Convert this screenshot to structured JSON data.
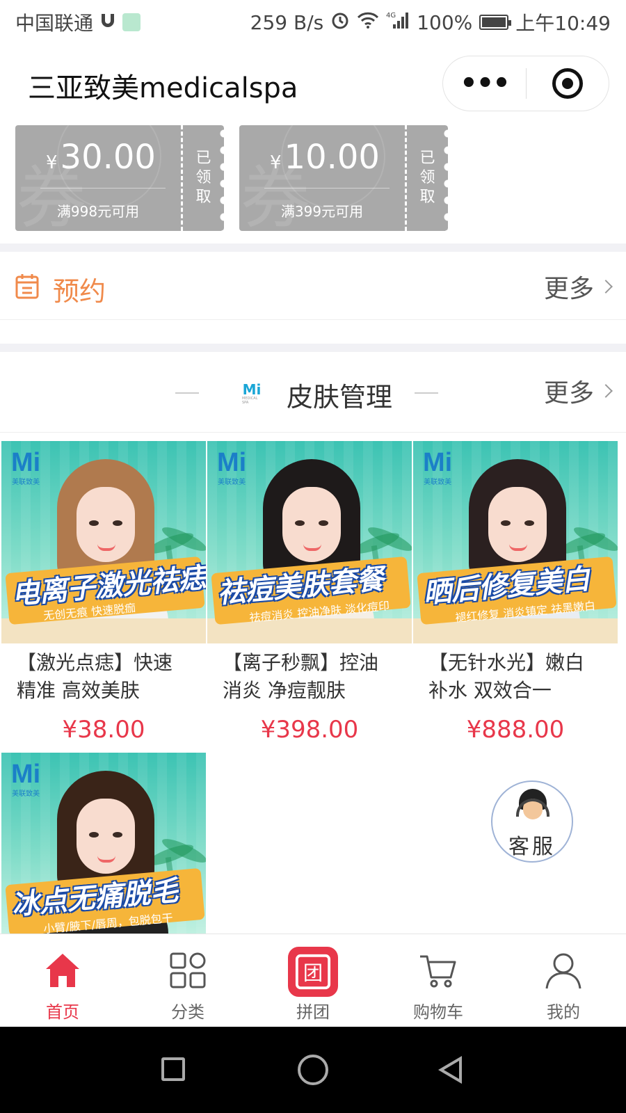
{
  "status_bar": {
    "carrier": "中国联通",
    "speed": "259 B/s",
    "network": "4G",
    "battery": "100%",
    "time": "上午10:49"
  },
  "navbar": {
    "title": "三亚致美medicalspa",
    "more_icon": "more-dots-icon",
    "close_icon": "target-circle-icon"
  },
  "coupons": [
    {
      "amount": "30.00",
      "currency": "¥",
      "condition": "满998元可用",
      "status": "已领取",
      "watermark": "券"
    },
    {
      "amount": "10.00",
      "currency": "¥",
      "condition": "满399元可用",
      "status": "已领取",
      "watermark": "券"
    }
  ],
  "appointment": {
    "label": "预约",
    "more": "更多",
    "accent": "#f08a4b"
  },
  "section": {
    "title": "皮肤管理",
    "more": "更多",
    "logo_text": "Mi",
    "logo_sub": "MEDICAL SPA"
  },
  "products": [
    {
      "brand": "Mi",
      "brand_sub": "美联致美",
      "banner": "电离子激光祛痣",
      "banner_sub": "无创无痕  快速脱痂",
      "title": "【激光点痣】快速精准 高效美肤",
      "price": "¥38.00",
      "hair": "#b07a4e",
      "outfit": "#f2f2f2"
    },
    {
      "brand": "Mi",
      "brand_sub": "美联致美",
      "banner": "祛痘美肤套餐",
      "banner_sub": "祛痘消炎  控油净肤  淡化痘印",
      "title": "【离子秒飘】控油消炎 净痘靓肤",
      "price": "¥398.00",
      "hair": "#1e1a1a",
      "outfit": "#f5efe6"
    },
    {
      "brand": "Mi",
      "brand_sub": "美联致美",
      "banner": "晒后修复美白",
      "banner_sub": "褪红修复  消炎镇定  祛黑嫩白",
      "title": "【无针水光】嫩白补水 双效合一",
      "price": "¥888.00",
      "hair": "#2b2020",
      "outfit": "#e9edf2"
    },
    {
      "brand": "Mi",
      "brand_sub": "美联致美",
      "banner": "冰点无痛脱毛",
      "banner_sub": "小臂/腋下/唇周，包脱包干",
      "title": "",
      "price": "",
      "hair": "#3a2418",
      "outfit": "#222222"
    }
  ],
  "customer_service": {
    "label": "客服"
  },
  "tabbar": [
    {
      "label": "首页",
      "icon": "home-icon",
      "active": true
    },
    {
      "label": "分类",
      "icon": "category-grid-icon",
      "active": false
    },
    {
      "label": "拼团",
      "icon": "group-buy-icon",
      "active": false,
      "icon_text": "团"
    },
    {
      "label": "购物车",
      "icon": "cart-icon",
      "active": false
    },
    {
      "label": "我的",
      "icon": "user-icon",
      "active": false
    }
  ],
  "colors": {
    "price": "#e8374a",
    "active_tab": "#e8374a",
    "coupon_gray": "#a9a9a9"
  }
}
